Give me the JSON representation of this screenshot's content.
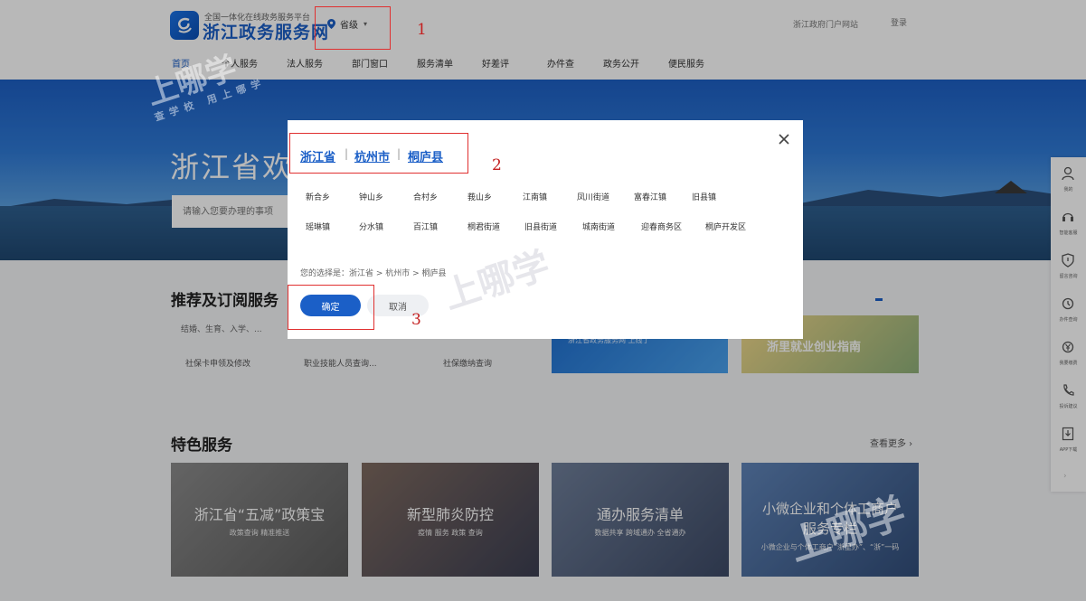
{
  "header": {
    "slogan": "全国一体化在线政务服务平台",
    "site_name": "浙江政务服务网",
    "location_label": "省级",
    "right_text": "浙江政府门户网站",
    "user_text": "登录"
  },
  "nav": [
    "首页",
    "个人服务",
    "法人服务",
    "部门窗口",
    "服务清单",
    "好差评",
    "办件查",
    "政务公开",
    "便民服务"
  ],
  "banner": {
    "title": "浙江省欢迎您",
    "search_placeholder": "请输入您要办理的事项"
  },
  "recommend": {
    "title": "推荐及订阅服务",
    "tags": "结婚、生育、入学、...",
    "links": [
      "社保卡申领及修改",
      "职业技能人员查询...",
      "社保缴纳查询"
    ],
    "card_blue_text": "浙江省政务服务网 上线了",
    "card_green_text": "浙里就业创业指南"
  },
  "features": {
    "title": "特色服务",
    "more": "查看更多 ›",
    "cards": [
      {
        "title": "浙江省“五减”政策宝",
        "sub": "政策查询  精准推送"
      },
      {
        "title": "新型肺炎防控",
        "sub": "疫情  服务  政策  查询"
      },
      {
        "title": "通办服务清单",
        "sub": "数据共享  跨域通办  全省通办"
      },
      {
        "title": "小微企业和个体工商户",
        "title2": "服务专栏",
        "sub": "小微企业与个体工商户“浙里办”、“浙”一码"
      }
    ]
  },
  "sidebar": [
    "我的",
    "智能客服",
    "留言咨询",
    "办件查询",
    "我要缴费",
    "投诉建议",
    "APP下载"
  ],
  "modal": {
    "crumbs": [
      "浙江省",
      "杭州市",
      "桐庐县"
    ],
    "towns_row1": [
      "新合乡",
      "钟山乡",
      "合村乡",
      "莪山乡",
      "江南镇",
      "凤川街道",
      "富春江镇",
      "旧县镇"
    ],
    "towns_row2": [
      "瑶琳镇",
      "分水镇",
      "百江镇",
      "桐君街道",
      "旧县街道",
      "城南街道",
      "迎春商务区",
      "桐庐开发区"
    ],
    "selected": "您的选择是：浙江省 > 杭州市 > 桐庐县",
    "confirm": "确定",
    "cancel": "取消"
  },
  "annotations": [
    "1",
    "2",
    "3"
  ],
  "watermarks": [
    "上哪学",
    "查学校 用上哪学"
  ]
}
